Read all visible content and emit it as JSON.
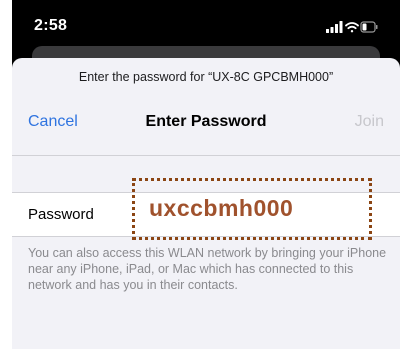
{
  "status_bar": {
    "time": "2:58",
    "icons": [
      "signal-icon",
      "wifi-icon",
      "battery-icon"
    ]
  },
  "dialog": {
    "prompt": "Enter the password for “UX-8C GPCBMH000”",
    "cancel_label": "Cancel",
    "title": "Enter Password",
    "join_label": "Join"
  },
  "field": {
    "label": "Password",
    "value": ""
  },
  "footnote": "You can also access this WLAN network by bringing your iPhone near any iPhone, iPad, or Mac which has connected to this network and has you in their contacts.",
  "callout": {
    "text": "uxccbmh000"
  },
  "colors": {
    "accent": "#2f74e0",
    "disabled": "#c7c7cc",
    "callout": "#a0522d",
    "sheet_background": "#f2f2f7"
  }
}
